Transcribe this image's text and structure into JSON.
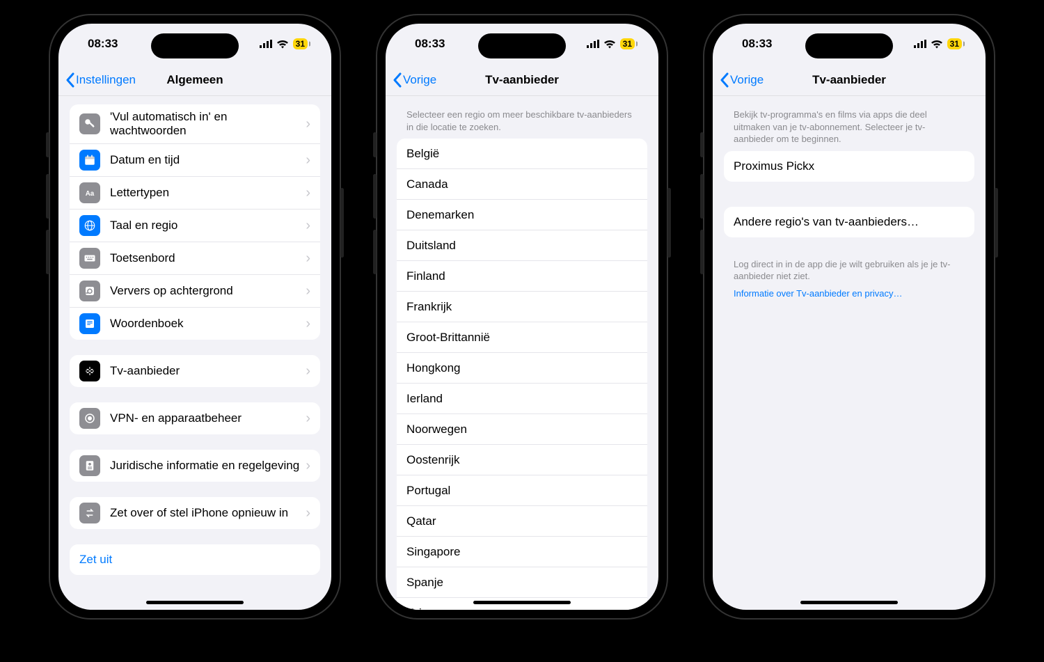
{
  "status": {
    "time": "08:33",
    "battery": "31"
  },
  "phone1": {
    "back": "Instellingen",
    "title": "Algemeen",
    "groupA": [
      {
        "icon": "key",
        "bg": "#8e8e93",
        "label": "'Vul automatisch in' en wachtwoorden"
      },
      {
        "icon": "calendar",
        "bg": "#007aff",
        "label": "Datum en tijd"
      },
      {
        "icon": "aa",
        "bg": "#8e8e93",
        "label": "Lettertypen"
      },
      {
        "icon": "globe",
        "bg": "#007aff",
        "label": "Taal en regio"
      },
      {
        "icon": "keyboard",
        "bg": "#8e8e93",
        "label": "Toetsenbord"
      },
      {
        "icon": "refresh",
        "bg": "#8e8e93",
        "label": "Ververs op achtergrond"
      },
      {
        "icon": "book",
        "bg": "#007aff",
        "label": "Woordenboek"
      }
    ],
    "groupB": [
      {
        "icon": "tv",
        "bg": "#000000",
        "label": "Tv-aanbieder"
      }
    ],
    "groupC": [
      {
        "icon": "vpn",
        "bg": "#8e8e93",
        "label": "VPN- en apparaatbeheer"
      }
    ],
    "groupD": [
      {
        "icon": "legal",
        "bg": "#8e8e93",
        "label": "Juridische informatie en regelgeving"
      }
    ],
    "groupE": [
      {
        "icon": "transfer",
        "bg": "#8e8e93",
        "label": "Zet over of stel iPhone opnieuw in"
      }
    ],
    "shutdown": "Zet uit"
  },
  "phone2": {
    "back": "Vorige",
    "title": "Tv-aanbieder",
    "header": "Selecteer een regio om meer beschikbare tv-aanbieders in die locatie te zoeken.",
    "regions": [
      "België",
      "Canada",
      "Denemarken",
      "Duitsland",
      "Finland",
      "Frankrijk",
      "Groot-Brittannië",
      "Hongkong",
      "Ierland",
      "Noorwegen",
      "Oostenrijk",
      "Portugal",
      "Qatar",
      "Singapore",
      "Spanje",
      "Taiwan"
    ]
  },
  "phone3": {
    "back": "Vorige",
    "title": "Tv-aanbieder",
    "header": "Bekijk tv-programma's en films via apps die deel uitmaken van je tv-abonnement. Selecteer je tv-aanbieder om te beginnen.",
    "provider": "Proximus Pickx",
    "other": "Andere regio's van tv-aanbieders…",
    "footer": "Log direct in in de app die je wilt gebruiken als je je tv-aanbieder niet ziet.",
    "privacy": "Informatie over Tv-aanbieder en privacy…"
  }
}
